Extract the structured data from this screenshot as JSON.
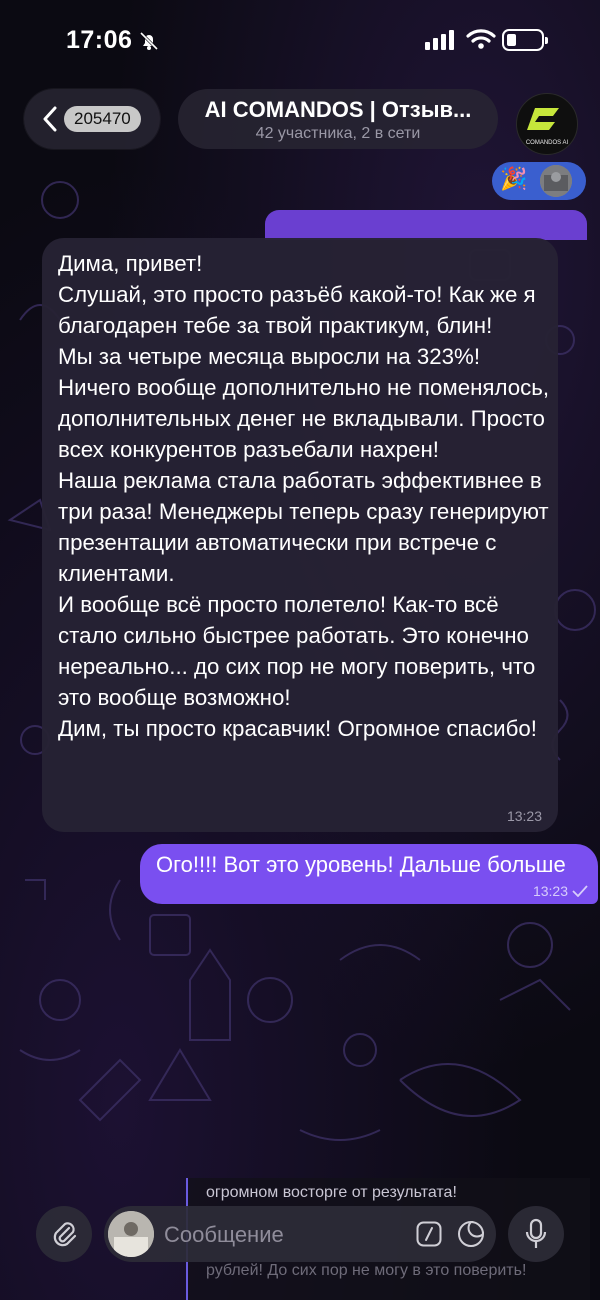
{
  "status_bar": {
    "time": "17:06",
    "icons": [
      "bell-off-icon",
      "signal-icon",
      "wifi-icon",
      "battery-icon"
    ]
  },
  "header": {
    "unread_count": "205470",
    "title": "AI COMANDOS | Отзыв...",
    "subtitle": "42 участника, 2 в сети",
    "avatar_text": "COMANDOS AI"
  },
  "reactions": {
    "emoji": "🎉"
  },
  "messages": [
    {
      "direction": "incoming",
      "text": "Дима, привет!\nСлушай, это просто разъёб какой-то! Как же я благодарен тебе за твой практикум, блин!\nМы за четыре месяца выросли на 323%! Ничего вообще дополнительно не поменялось, дополнительных денег не вкладывали. Просто всех конкурентов разъебали нахрен!\nНаша реклама стала работать эффективнее в три раза! Менеджеры теперь сразу генерируют презентации автоматически при встрече с клиентами.\nИ вообще всё просто полетело! Как-то всё стало сильно быстрее работать. Это конечно нереально... до сих пор не могу поверить, что это вообще возможно!\nДим, ты просто красавчик! Огромное спасибо!",
      "time": "13:23"
    },
    {
      "direction": "outgoing",
      "text": "Ого!!!! Вот это уровень! Дальше больше",
      "time": "13:23",
      "status": "sent-check"
    }
  ],
  "reply_preview": {
    "line1": "огромном восторге от результата!",
    "line2": "рублей! До сих пор не могу в это поверить!"
  },
  "composer": {
    "placeholder": "Сообщение"
  },
  "colors": {
    "outgoing_bubble": "#7a4ff0",
    "incoming_bubble": "#262234",
    "reaction_pill": "#3a5fcf",
    "background": "#0b0a12"
  }
}
